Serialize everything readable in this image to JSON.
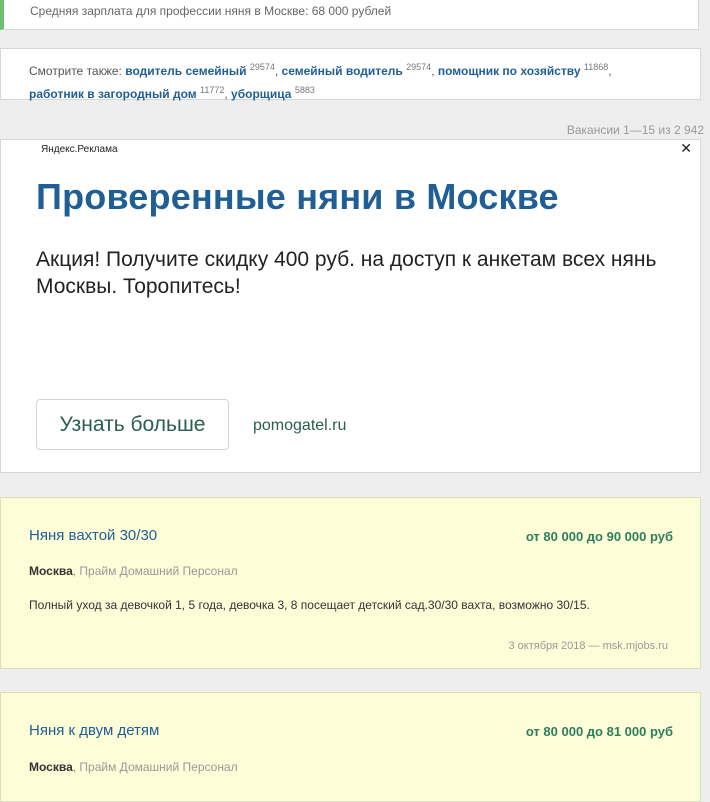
{
  "salary_line": "Средняя зарплата для профессии няня в Москве: 68 000 рублей",
  "see_also": {
    "prefix": "Смотрите также:",
    "links": [
      {
        "label": "водитель семейный",
        "count": "29574"
      },
      {
        "label": "семейный водитель",
        "count": "29574"
      },
      {
        "label": "помощник по хозяйству",
        "count": "11868"
      },
      {
        "label": "работник в загородный дом",
        "count": "11772"
      },
      {
        "label": "уборщица",
        "count": "5883"
      }
    ]
  },
  "vacancy_count": "Вакансии 1—15 из 2 942",
  "ad": {
    "label": "Яндекс.Реклама",
    "close": "✕",
    "title": "Проверенные няни в Москве",
    "description": "Акция! Получите скидку 400 руб. на доступ к анкетам всех нянь Москвы. Торопитесь!",
    "button": "Узнать больше",
    "domain": "pomogatel.ru"
  },
  "jobs": [
    {
      "title": "Няня вахтой 30/30",
      "salary": "от 80 000 до 90 000 руб",
      "city": "Москва",
      "company": ", Прайм Домашний Персонал",
      "description": "Полный уход за девочкой 1, 5 года, девочка 3, 8 посещает детский сад.30/30 вахта, возможно 30/15.",
      "meta": "3 октября 2018 — msk.mjobs.ru"
    },
    {
      "title": "Няня к двум детям",
      "salary": "от 80 000 до 81 000 руб",
      "city": "Москва",
      "company": ", Прайм Домашний Персонал"
    }
  ]
}
